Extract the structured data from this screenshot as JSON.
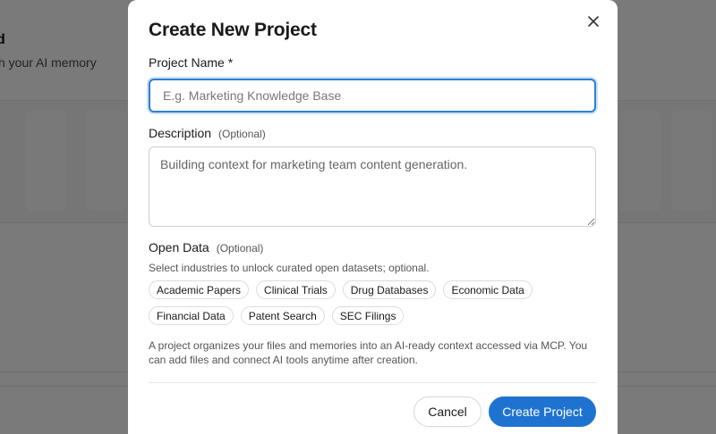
{
  "background": {
    "title_fragment": "d",
    "subtitle_fragment": "h your AI memory"
  },
  "modal": {
    "title": "Create New Project",
    "close_icon": "close-icon",
    "project_name": {
      "label": "Project Name *",
      "value": "",
      "placeholder": "E.g. Marketing Knowledge Base"
    },
    "description": {
      "label": "Description",
      "optional": "(Optional)",
      "value": "",
      "placeholder": "Building context for marketing team content generation."
    },
    "open_data": {
      "label": "Open Data",
      "optional": "(Optional)",
      "helper": "Select industries to unlock curated open datasets; optional.",
      "chips": [
        "Academic Papers",
        "Clinical Trials",
        "Drug Databases",
        "Economic Data",
        "Financial Data",
        "Patent Search",
        "SEC Filings"
      ]
    },
    "info_text": "A project organizes your files and memories into an AI-ready context accessed via MCP. You can add files and connect AI tools anytime after creation.",
    "buttons": {
      "cancel": "Cancel",
      "create": "Create Project"
    }
  },
  "colors": {
    "accent": "#1f73d0",
    "focus_border": "#2d7fd6",
    "overlay": "rgba(0,0,0,0.5)"
  }
}
